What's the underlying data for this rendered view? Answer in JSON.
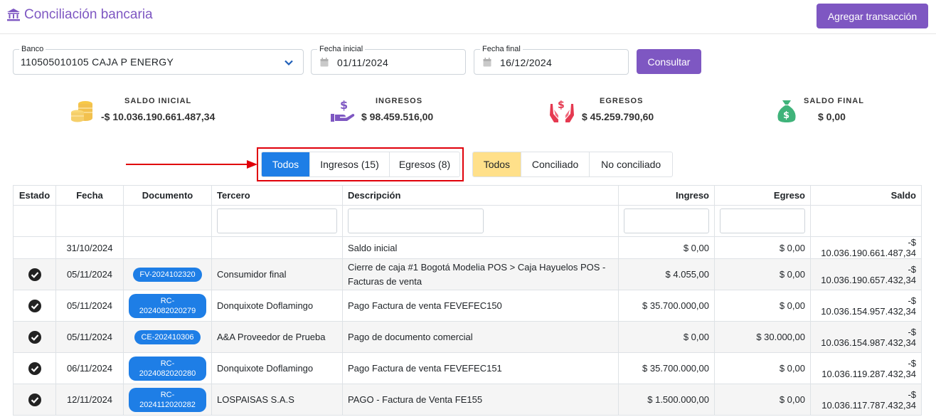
{
  "header": {
    "title": "Conciliación bancaria",
    "add_button": "Agregar transacción"
  },
  "filters": {
    "bank_label": "Banco",
    "bank_value": "110505010105 CAJA P ENERGY",
    "start_label": "Fecha inicial",
    "start_value": "01/11/2024",
    "end_label": "Fecha final",
    "end_value": "16/12/2024",
    "consult_button": "Consultar"
  },
  "summary": {
    "saldo_inicial_label": "SALDO INICIAL",
    "saldo_inicial_value": "-$ 10.036.190.661.487,34",
    "ingresos_label": "INGRESOS",
    "ingresos_value": "$ 98.459.516,00",
    "egresos_label": "EGRESOS",
    "egresos_value": "$ 45.259.790,60",
    "saldo_final_label": "SALDO FINAL",
    "saldo_final_value": "$ 0,00"
  },
  "type_filter": {
    "options": [
      "Todos",
      "Ingresos (15)",
      "Egresos (8)"
    ],
    "selected": "Todos"
  },
  "status_filter": {
    "options": [
      "Todos",
      "Conciliado",
      "No conciliado"
    ],
    "selected": "Todos"
  },
  "table": {
    "columns": [
      "Estado",
      "Fecha",
      "Documento",
      "Tercero",
      "Descripción",
      "Ingreso",
      "Egreso",
      "Saldo"
    ],
    "initial_row": {
      "fecha": "31/10/2024",
      "descripcion": "Saldo inicial",
      "ingreso": "$ 0,00",
      "egreso": "$ 0,00",
      "saldo": "-$ 10.036.190.661.487,34"
    },
    "rows": [
      {
        "fecha": "05/11/2024",
        "documento": "FV-2024102320",
        "tercero": "Consumidor final",
        "descripcion": "Cierre de caja #1 Bogotá Modelia POS > Caja Hayuelos POS - Facturas de venta",
        "ingreso": "$ 4.055,00",
        "egreso": "$ 0,00",
        "saldo": "-$ 10.036.190.657.432,34"
      },
      {
        "fecha": "05/11/2024",
        "documento": "RC-2024082020279",
        "tercero": "Donquixote Doflamingo",
        "descripcion": "Pago Factura de venta FEVEFEC150",
        "ingreso": "$ 35.700.000,00",
        "egreso": "$ 0,00",
        "saldo": "-$ 10.036.154.957.432,34"
      },
      {
        "fecha": "05/11/2024",
        "documento": "CE-202410306",
        "tercero": "A&A Proveedor de Prueba",
        "descripcion": "Pago de documento comercial",
        "ingreso": "$ 0,00",
        "egreso": "$ 30.000,00",
        "saldo": "-$ 10.036.154.987.432,34"
      },
      {
        "fecha": "06/11/2024",
        "documento": "RC-2024082020280",
        "tercero": "Donquixote Doflamingo",
        "descripcion": "Pago Factura de venta FEVEFEC151",
        "ingreso": "$ 35.700.000,00",
        "egreso": "$ 0,00",
        "saldo": "-$ 10.036.119.287.432,34"
      },
      {
        "fecha": "12/11/2024",
        "documento": "RC-2024112020282",
        "tercero": "LOSPAISAS S.A.S",
        "descripcion": "PAGO - Factura de Venta FE155",
        "ingreso": "$ 1.500.000,00",
        "egreso": "$ 0,00",
        "saldo": "-$ 10.036.117.787.432,34"
      }
    ]
  },
  "colors": {
    "accent": "#7e57c2",
    "selected_blue": "#1e7ee6",
    "selected_yellow": "#ffe08a",
    "annotation_red": "#e0000a"
  },
  "icons": {
    "title": "bank-icon",
    "saldo_inicial": "coins-icon",
    "ingresos": "hand-dollar-icon",
    "egresos": "hands-dollar-icon",
    "saldo_final": "money-bag-icon",
    "estado": "check-circle-icon"
  }
}
